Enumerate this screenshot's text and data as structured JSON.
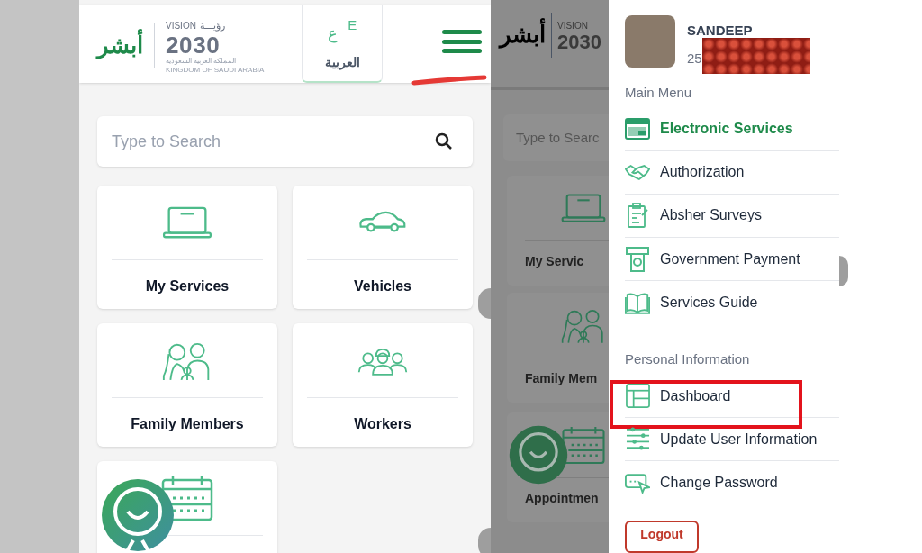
{
  "left_screen": {
    "header": {
      "absher_logo": "أبشر",
      "vision_logo": {
        "word": "VISION",
        "arabic": "رؤيـــة",
        "year": "2030",
        "arabic_country": "المملكة العربية السعودية",
        "country": "KINGDOM OF SAUDI ARABIA"
      },
      "language_button": {
        "icon_letters": [
          "E",
          "ع"
        ],
        "label": "العربية"
      }
    },
    "search": {
      "placeholder": "Type to Search"
    },
    "tiles": [
      {
        "kind": "laptop",
        "label": "My Services"
      },
      {
        "kind": "car",
        "label": "Vehicles"
      },
      {
        "kind": "family",
        "label": "Family Members"
      },
      {
        "kind": "workers",
        "label": "Workers"
      },
      {
        "kind": "calendar"
      }
    ]
  },
  "right_screen": {
    "dimmed_background": {
      "absher_logo": "أبشر",
      "vision_word": "VISION",
      "vision_year": "2030",
      "search_placeholder": "Type to Searc",
      "tiles": [
        {
          "kind": "laptop",
          "label": "My Servic"
        },
        {
          "kind": "family",
          "label": "Family Mem"
        },
        {
          "kind": "calendar",
          "label": "Appointmen"
        }
      ]
    },
    "drawer": {
      "user": {
        "name": "SANDEEP",
        "id": "25"
      },
      "sections": [
        {
          "title": "Main Menu",
          "items": [
            {
              "kind": "services",
              "label": "Electronic Services",
              "selected": true,
              "outlined": false
            },
            {
              "kind": "handshake",
              "label": "Authorization",
              "selected": false,
              "outlined": false
            },
            {
              "kind": "survey",
              "label": "Absher Surveys",
              "selected": false,
              "outlined": false
            },
            {
              "kind": "payment",
              "label": "Government Payment",
              "selected": false,
              "outlined": false
            },
            {
              "kind": "guide",
              "label": "Services Guide",
              "selected": false,
              "outlined": false
            }
          ]
        },
        {
          "title": "Personal Information",
          "items": [
            {
              "kind": "dashboard",
              "label": "Dashboard",
              "selected": false,
              "outlined": true
            },
            {
              "kind": "update",
              "label": "Update User Information",
              "selected": false,
              "outlined": false
            },
            {
              "kind": "password",
              "label": "Change Password",
              "selected": false,
              "outlined": false
            }
          ]
        }
      ],
      "logout": "Logout"
    }
  }
}
